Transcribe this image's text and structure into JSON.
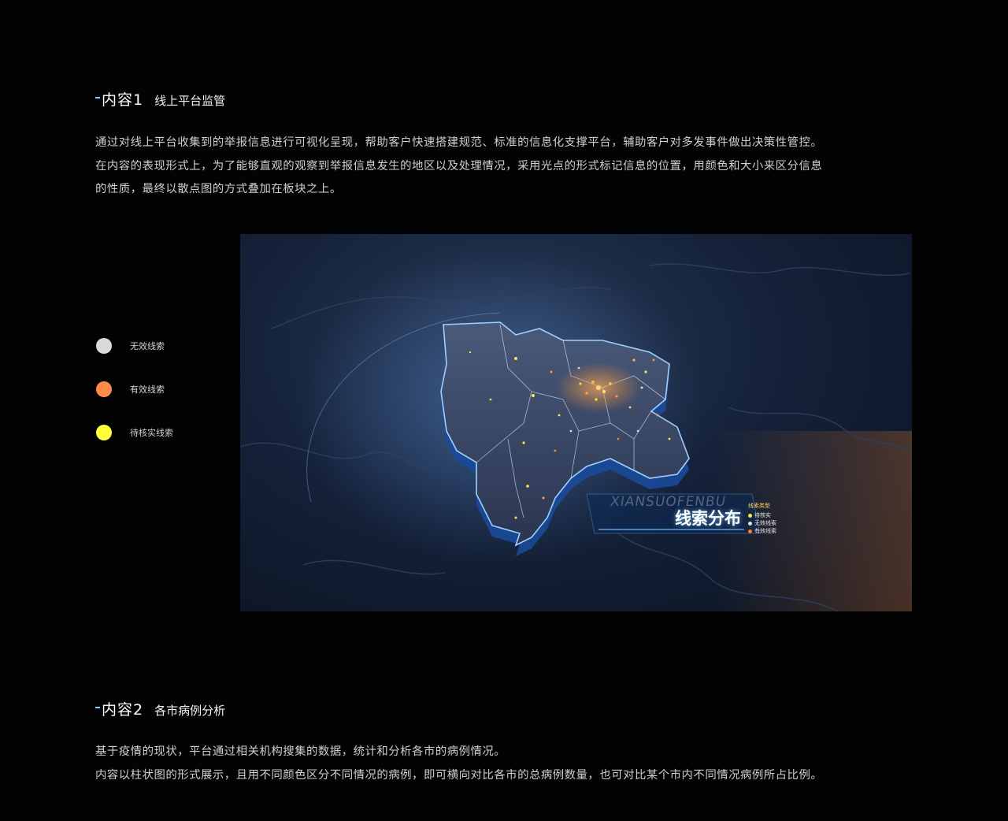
{
  "section1": {
    "title": "内容1",
    "subtitle": "线上平台监管",
    "paragraphs": [
      "通过对线上平台收集到的举报信息进行可视化呈现，帮助客户快速搭建规范、标准的信息化支撑平台，辅助客户对多发事件做出决策性管控。",
      "在内容的表现形式上，为了能够直观的观察到举报信息发生的地区以及处理情况，采用光点的形式标记信息的位置，用颜色和大小来区分信息",
      "的性质，最终以散点图的方式叠加在板块之上。"
    ]
  },
  "legend": [
    {
      "label": "无效线索",
      "color": "#d9d9d9"
    },
    {
      "label": "有效线索",
      "color": "#ff8a4c"
    },
    {
      "label": "待核实线索",
      "color": "#ffff3a"
    }
  ],
  "map": {
    "caption_en": "XIANSUOFENBU",
    "caption_cn": "线索分布",
    "mini_legend_title": "线索类型",
    "mini_legend": [
      {
        "label": "待核实",
        "color": "#ffe640"
      },
      {
        "label": "无效线索",
        "color": "#e0e0e0"
      },
      {
        "label": "有效线索",
        "color": "#ff7a30"
      }
    ]
  },
  "section2": {
    "title": "内容2",
    "subtitle": "各市病例分析",
    "paragraphs": [
      "基于疫情的现状，平台通过相关机构搜集的数据，统计和分析各市的病例情况。",
      "内容以柱状图的形式展示，且用不同颜色区分不同情况的病例，即可横向对比各市的总病例数量，也可对比某个市内不同情况病例所占比例。"
    ]
  }
}
